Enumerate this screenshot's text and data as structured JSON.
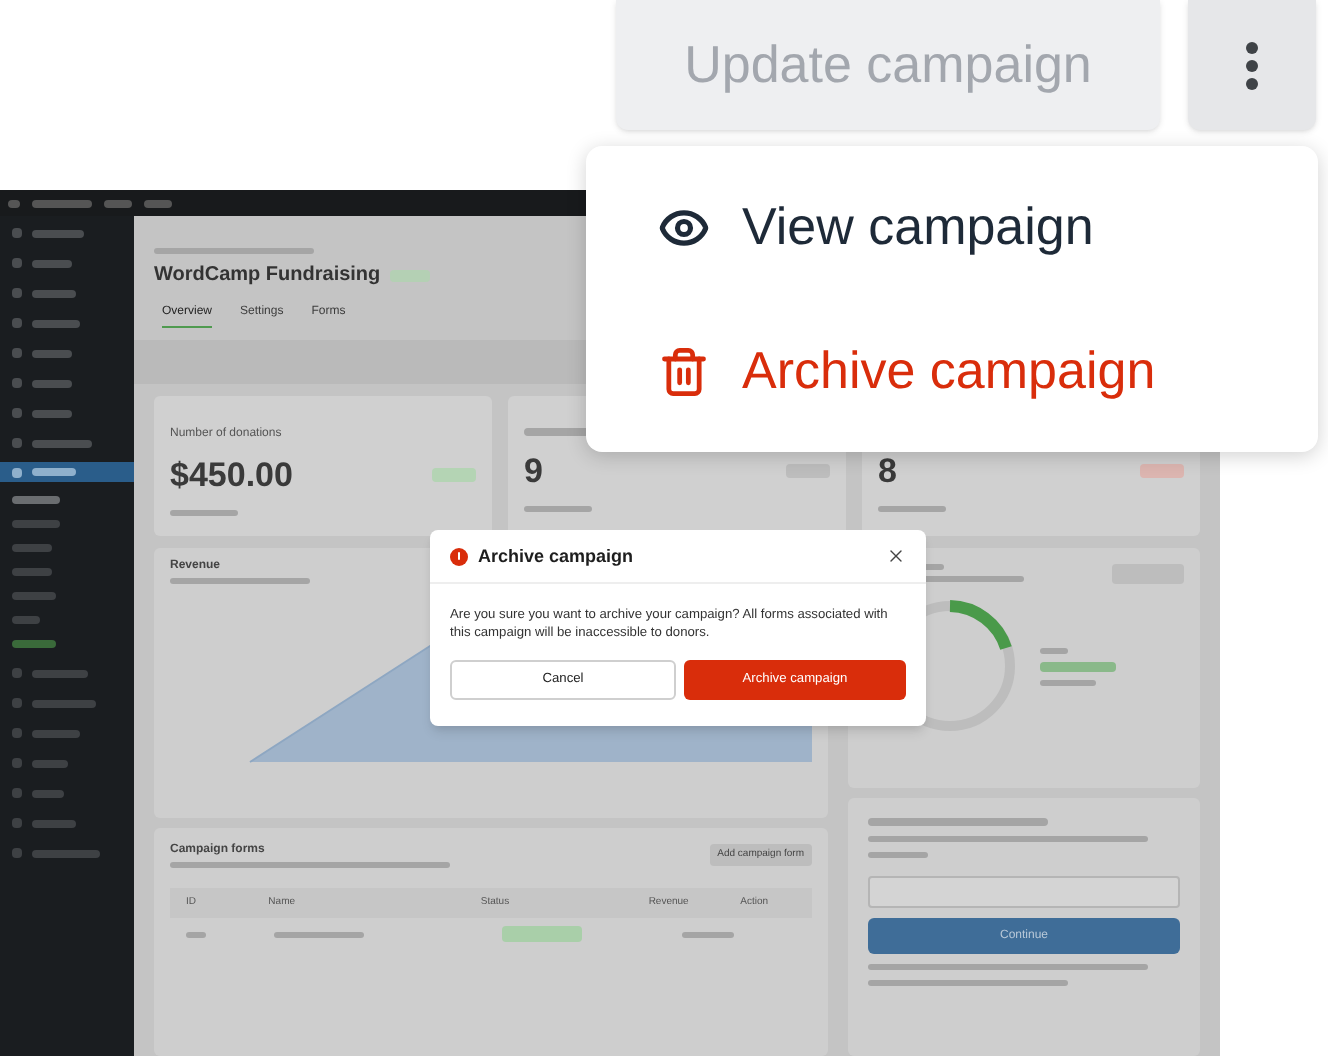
{
  "toolbar": {
    "update_button": {
      "label": "Update campaign",
      "disabled": true
    }
  },
  "menu": {
    "items": [
      {
        "label": "View campaign",
        "kind": "view"
      },
      {
        "label": "Archive campaign",
        "kind": "danger"
      }
    ]
  },
  "screenshot": {
    "title": "WordCamp Fundraising",
    "tabs": [
      {
        "label": "Overview",
        "selected": true
      },
      {
        "label": "Settings",
        "selected": false
      },
      {
        "label": "Forms",
        "selected": false
      }
    ],
    "stats": [
      {
        "label": "Number of donations",
        "value": "$450.00",
        "color": "#b4d4b4"
      },
      {
        "value": "9",
        "color": "#bdbdbd"
      },
      {
        "value": "8",
        "color": "#dcb5b0"
      }
    ],
    "revenue": {
      "title": "Revenue"
    },
    "forms": {
      "title": "Campaign forms",
      "button": "Add campaign form",
      "columns": [
        "ID",
        "Name",
        "Status",
        "Revenue",
        "Action"
      ]
    },
    "license": {
      "button": "Continue"
    }
  },
  "dialog": {
    "title": "Archive campaign",
    "message": "Are you sure you want to archive your campaign? All forms associated with this campaign will be inaccessible to donors.",
    "buttons": [
      {
        "label": "Cancel",
        "kind": "secondary"
      },
      {
        "label": "Archive campaign",
        "kind": "danger"
      }
    ]
  }
}
